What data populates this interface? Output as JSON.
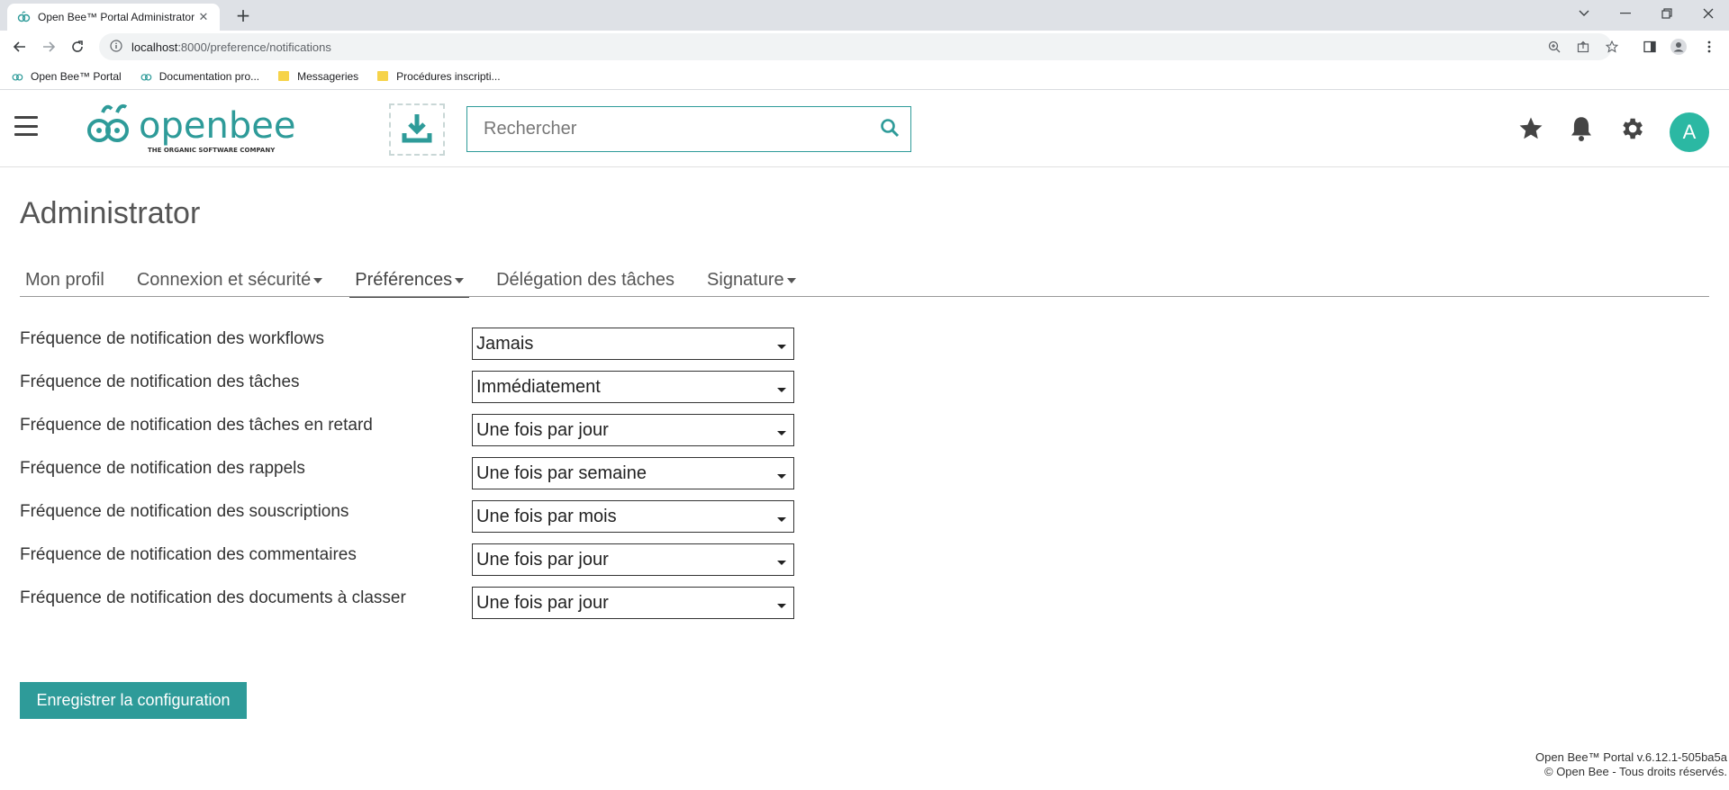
{
  "browser": {
    "tab_title": "Open Bee™ Portal Administrator",
    "tab_close": "✕",
    "new_tab": "+",
    "url_host": "localhost",
    "url_path": ":8000/preference/notifications",
    "bookmarks": [
      {
        "label": "Open Bee™ Portal",
        "icon": "bee-icon"
      },
      {
        "label": "Documentation pro...",
        "icon": "bee-icon"
      },
      {
        "label": "Messageries",
        "icon": "folder-icon"
      },
      {
        "label": "Procédures inscripti...",
        "icon": "folder-icon"
      }
    ]
  },
  "header": {
    "logo_text": "openbee",
    "logo_tagline": "THE ORGANIC SOFTWARE COMPANY",
    "search_placeholder": "Rechercher",
    "avatar_initial": "A",
    "brand_color": "#2e9b99"
  },
  "page": {
    "title": "Administrator",
    "tabs": [
      {
        "label": "Mon profil",
        "caret": false
      },
      {
        "label": "Connexion et sécurité",
        "caret": true
      },
      {
        "label": "Préférences",
        "caret": true,
        "active": true
      },
      {
        "label": "Délégation des tâches",
        "caret": false
      },
      {
        "label": "Signature",
        "caret": true
      }
    ]
  },
  "form": {
    "rows": [
      {
        "label": "Fréquence de notification des workflows",
        "value": "Jamais"
      },
      {
        "label": "Fréquence de notification des tâches",
        "value": "Immédiatement"
      },
      {
        "label": "Fréquence de notification des tâches en retard",
        "value": "Une fois par jour"
      },
      {
        "label": "Fréquence de notification des rappels",
        "value": "Une fois par semaine"
      },
      {
        "label": "Fréquence de notification des souscriptions",
        "value": "Une fois par mois"
      },
      {
        "label": "Fréquence de notification des commentaires",
        "value": "Une fois par jour"
      },
      {
        "label": "Fréquence de notification des documents à classer",
        "value": "Une fois par jour"
      }
    ],
    "save_label": "Enregistrer la configuration"
  },
  "footer": {
    "version": "Open Bee™ Portal v.6.12.1-505ba5a",
    "copyright": "© Open Bee - Tous droits réservés."
  }
}
